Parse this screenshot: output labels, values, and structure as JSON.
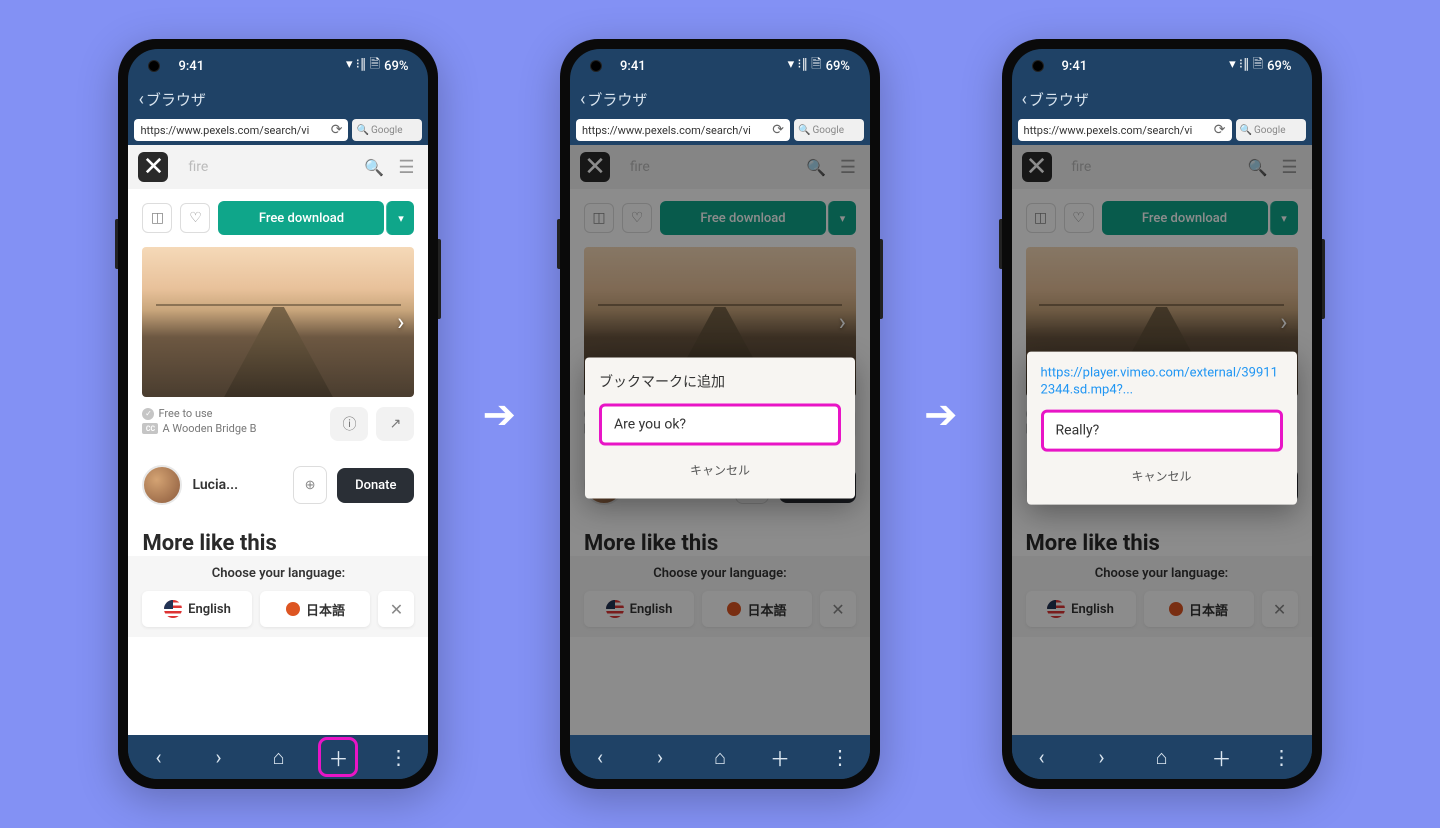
{
  "status": {
    "time": "9:41",
    "battery": "69%"
  },
  "header": {
    "title": "ブラウザ"
  },
  "url": "https://www.pexels.com/search/vi",
  "google": "Google",
  "search": {
    "placeholder": "fire"
  },
  "toolbar": {
    "download": "Free download"
  },
  "meta": {
    "free": "Free to use",
    "title": "A Wooden Bridge B"
  },
  "author": {
    "name": "Lucia...",
    "donate": "Donate"
  },
  "more": "More like this",
  "lang": {
    "heading": "Choose your language:",
    "english": "English",
    "japanese": "日本語"
  },
  "dialogs": {
    "bookmark": {
      "title": "ブックマークに追加",
      "input": "Are you ok?",
      "cancel": "キャンセル"
    },
    "video": {
      "link": "https://player.vimeo.com/external/399112344.sd.mp4?...",
      "input": "Really?",
      "cancel": "キャンセル"
    }
  }
}
